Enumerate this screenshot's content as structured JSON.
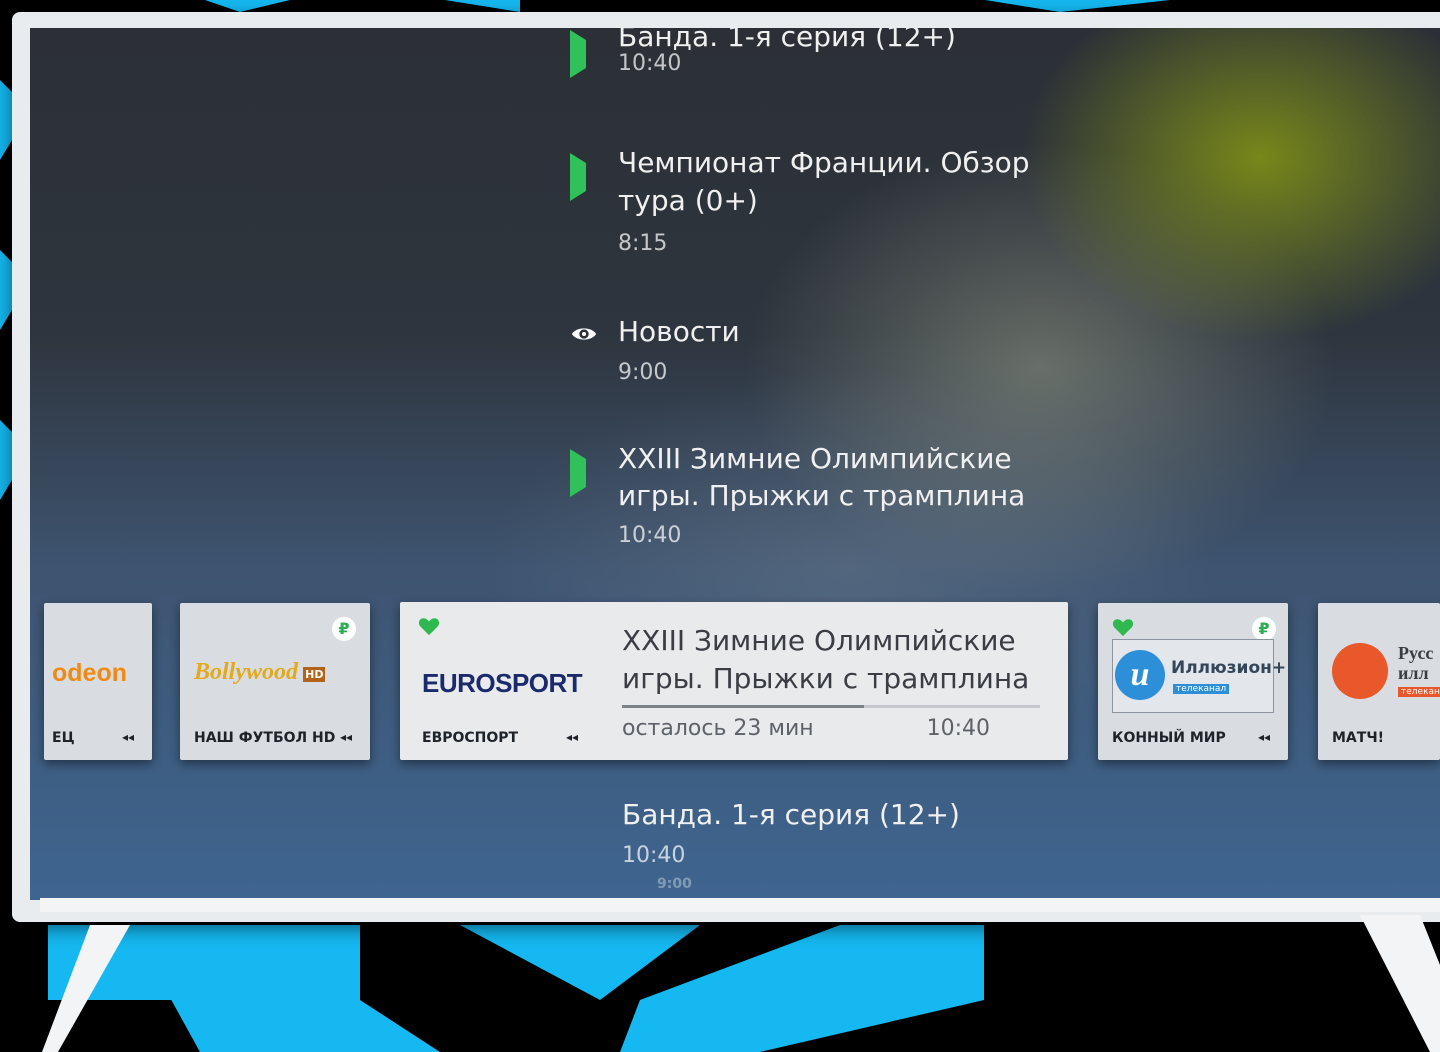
{
  "epg": {
    "items": [
      {
        "title": "Банда. 1-я серия (12+)",
        "time": "10:40",
        "icon": "play-icon"
      },
      {
        "title_line1": "Чемпионат Франции. Обзор",
        "title_line2": "тура (0+)",
        "time": "8:15",
        "icon": "play-icon"
      },
      {
        "title": "Новости",
        "time": "9:00",
        "icon": "eye-icon"
      },
      {
        "title_line1": "XXIII Зимние Олимпийские",
        "title_line2": "игры. Прыжки с трамплина",
        "time": "10:40",
        "icon": "play-icon"
      }
    ],
    "next": {
      "title": "Банда. 1-я серия (12+)",
      "time": "10:40",
      "small_time": "9:00"
    }
  },
  "channels": [
    {
      "logo": "odeon",
      "name": "ЕЦ"
    },
    {
      "logo": "Bollywood",
      "logo_badge": "HD",
      "name": "НАШ ФУТБОЛ HD",
      "paid": "₽"
    },
    {
      "logo": "EUROSPORT",
      "name": "ЕВРОСПОРТ",
      "favorite": true
    },
    {
      "logo": "Иллюзион+",
      "logo_sub": "телеканал",
      "name": "КОННЫЙ МИР",
      "favorite": true,
      "paid": "₽"
    },
    {
      "logo_line1": "Русс",
      "logo_line2": "илл",
      "logo_sub": "телекан",
      "name": "МАТЧ!"
    }
  ],
  "active": {
    "title_line1": "XXIII Зимние Олимпийские",
    "title_line2": "игры. Прыжки с трамплина",
    "remaining": "осталось 23 мин",
    "start_time": "10:40",
    "progress": 0.58
  },
  "rewind_glyph": "◂◂",
  "colors": {
    "accent_green": "#31c15a",
    "cyan_shape": "#00b3ff",
    "frame": "#e9ecef"
  }
}
